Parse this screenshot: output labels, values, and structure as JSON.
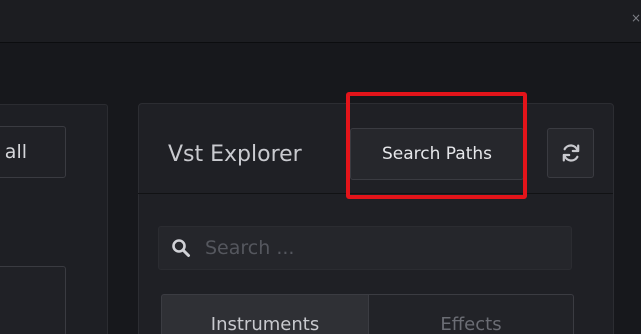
{
  "window": {
    "close_glyph": "×"
  },
  "left_panel": {
    "top_button_label": "all"
  },
  "vst_explorer": {
    "title": "Vst Explorer",
    "search_paths_label": "Search Paths",
    "refresh_icon": "refresh-icon",
    "search": {
      "value": "",
      "placeholder": "Search ..."
    },
    "tabs": [
      {
        "label": "Instruments",
        "active": true
      },
      {
        "label": "Effects",
        "active": false
      }
    ]
  },
  "annotation": {
    "highlight_color": "#e3141a",
    "highlighted": "search-paths-button"
  },
  "colors": {
    "background": "#17181c",
    "panel": "#1f2025",
    "button": "#26272c",
    "text": "#c9cacf",
    "muted_text": "#6b6d74"
  }
}
